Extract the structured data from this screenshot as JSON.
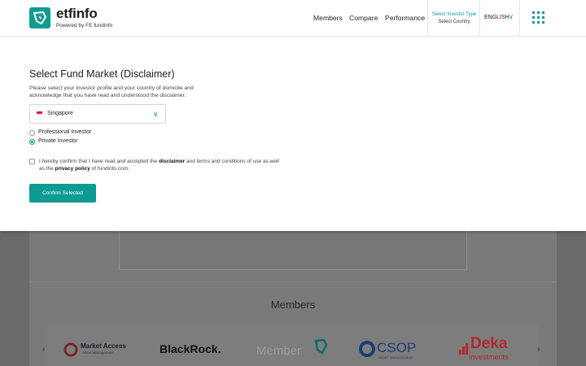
{
  "header": {
    "brand": "etfinfo",
    "powered_by": "Powered by FE fundinfo",
    "nav": [
      "Members",
      "Compare",
      "Performance"
    ],
    "investor_type_label": "Select Investor Type",
    "country_label": "Select Country",
    "language": "ENGLISH",
    "accent_color": "#0e9b93"
  },
  "modal": {
    "title": "Select Fund Market (Disclaimer)",
    "description": "Please select your investor profile and your country of domicile and acknowledge that you have read and understood the disclaimer.",
    "country_select": {
      "value": "Singapore"
    },
    "investor_options": [
      {
        "label": "Professional Investor",
        "selected": false
      },
      {
        "label": "Private Investor",
        "selected": true
      }
    ],
    "consent": {
      "part1": "I hereby confirm that I have read and accepted the ",
      "link1": "disclaimer",
      "part2": " and terms and conditions of use as well as the ",
      "link2": "privacy policy",
      "part3": " of fundinfo.com."
    },
    "confirm_button": "Confirm Selected"
  },
  "background": {
    "members_title": "Members",
    "member_logos": [
      "Market Access",
      "Asset Management",
      "BlackRock.",
      "Member",
      "CSOP",
      "ASSET MANAGEMENT",
      "Deka",
      "Investments"
    ]
  }
}
